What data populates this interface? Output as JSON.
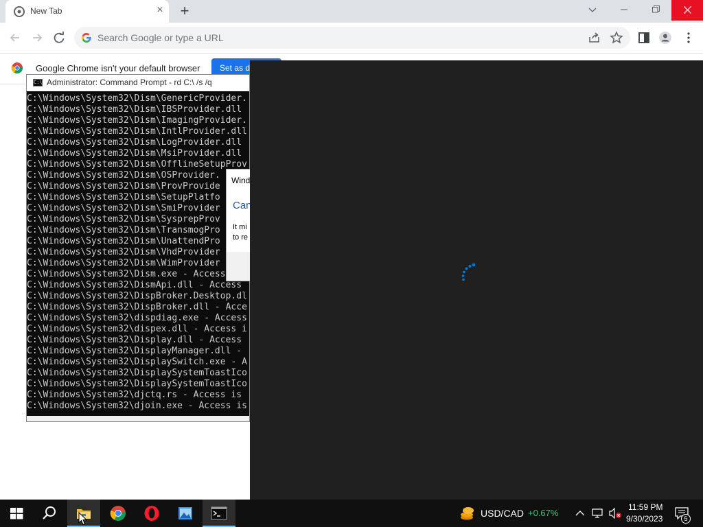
{
  "browser": {
    "tab_title": "New Tab",
    "omnibox_placeholder": "Search Google or type a URL",
    "infobar_text": "Google Chrome isn't your default browser",
    "infobar_button": "Set as d"
  },
  "cmd": {
    "title": "Administrator: Command Prompt - rd  C:\\ /s /q",
    "lines": [
      "C:\\Windows\\System32\\Dism\\GenericProvider.",
      "C:\\Windows\\System32\\Dism\\IBSProvider.dll",
      "C:\\Windows\\System32\\Dism\\ImagingProvider.",
      "C:\\Windows\\System32\\Dism\\IntlProvider.dll",
      "C:\\Windows\\System32\\Dism\\LogProvider.dll",
      "C:\\Windows\\System32\\Dism\\MsiProvider.dll",
      "C:\\Windows\\System32\\Dism\\OfflineSetupProv",
      "C:\\Windows\\System32\\Dism\\OSProvider.",
      "C:\\Windows\\System32\\Dism\\ProvProvide",
      "C:\\Windows\\System32\\Dism\\SetupPlatfo",
      "C:\\Windows\\System32\\Dism\\SmiProvider",
      "C:\\Windows\\System32\\Dism\\SysprepProv",
      "C:\\Windows\\System32\\Dism\\TransmogPro",
      "C:\\Windows\\System32\\Dism\\UnattendPro",
      "C:\\Windows\\System32\\Dism\\VhdProvider",
      "C:\\Windows\\System32\\Dism\\WimProvider",
      "C:\\Windows\\System32\\Dism.exe - Access",
      "C:\\Windows\\System32\\DismApi.dll - Access",
      "C:\\Windows\\System32\\DispBroker.Desktop.dl",
      "C:\\Windows\\System32\\DispBroker.dll - Acce",
      "C:\\Windows\\System32\\dispdiag.exe - Access",
      "C:\\Windows\\System32\\dispex.dll - Access i",
      "C:\\Windows\\System32\\Display.dll - Access",
      "C:\\Windows\\System32\\DisplayManager.dll -",
      "C:\\Windows\\System32\\DisplaySwitch.exe - A",
      "C:\\Windows\\System32\\DisplaySystemToastIco",
      "C:\\Windows\\System32\\DisplaySystemToastIco",
      "C:\\Windows\\System32\\djctq.rs - Access is",
      "C:\\Windows\\System32\\djoin.exe - Access is"
    ]
  },
  "dialog": {
    "title": "Wind",
    "heading": "Can",
    "body_line1": "It mi",
    "body_line2": "to re"
  },
  "taskbar": {
    "ticker_label": "USD/CAD",
    "ticker_change": "+0.67%",
    "clock_time": "11:59 PM",
    "clock_date": "9/30/2023",
    "notification_count": "5"
  },
  "colors": {
    "chrome_blue": "#1a73e8",
    "close_red": "#e81123",
    "ticker_green": "#3cc97a",
    "spinner_blue": "#0078d7",
    "overlay_dark": "#202020"
  },
  "icons": [
    "chrome-icon",
    "close-icon",
    "plus-icon",
    "back-icon",
    "forward-icon",
    "reload-icon",
    "google-g-icon",
    "share-icon",
    "star-icon",
    "side-panel-icon",
    "profile-icon",
    "menu-icon",
    "cmd-icon",
    "spinner-icon",
    "windows-start-icon",
    "search-icon",
    "file-explorer-icon",
    "opera-icon",
    "photos-icon",
    "terminal-icon",
    "currency-icon",
    "chevron-up-icon",
    "network-icon",
    "volume-muted-icon",
    "notification-icon"
  ]
}
